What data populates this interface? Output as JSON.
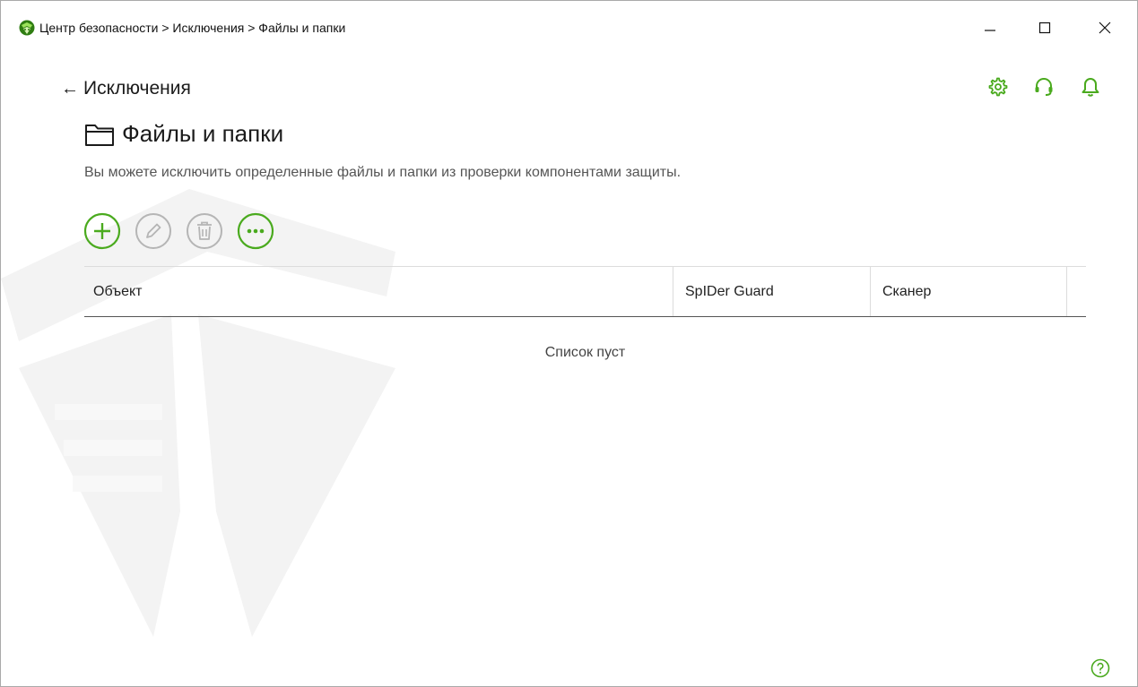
{
  "window": {
    "title": "Центр безопасности > Исключения > Файлы и папки",
    "controls": {
      "minimize": "—",
      "maximize": "☐",
      "close": "✕"
    }
  },
  "header": {
    "back_arrow": "←",
    "back_label": "Исключения",
    "icons": [
      "gear-icon",
      "headset-icon",
      "bell-icon"
    ]
  },
  "page": {
    "title": "Файлы и папки",
    "description": "Вы можете исключить определенные файлы и папки из проверки компонентами защиты."
  },
  "toolbar": {
    "buttons": [
      {
        "icon": "plus-icon",
        "state": "enabled"
      },
      {
        "icon": "pencil-icon",
        "state": "disabled"
      },
      {
        "icon": "trash-icon",
        "state": "disabled"
      },
      {
        "icon": "more-icon",
        "state": "enabled"
      }
    ]
  },
  "table": {
    "columns": [
      "Объект",
      "SpIDer Guard",
      "Сканер"
    ],
    "rows": [],
    "empty_text": "Список пуст"
  },
  "colors": {
    "accent": "#4aaa1e",
    "disabled": "#b5b5b5",
    "text": "#1b1b1b"
  }
}
